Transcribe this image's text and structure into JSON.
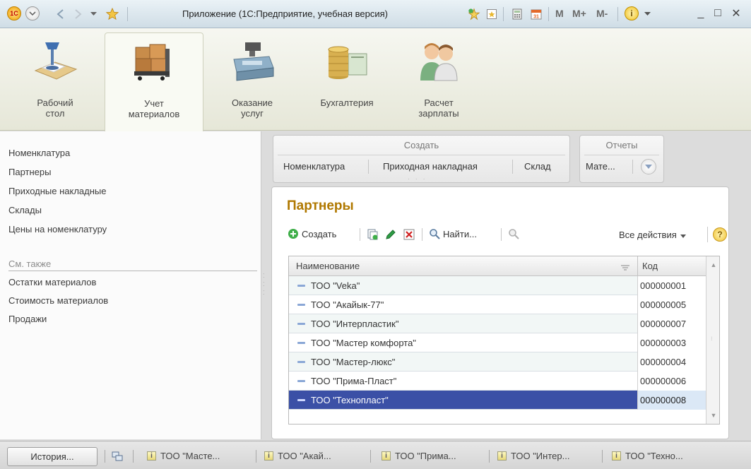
{
  "titlebar": {
    "logo_text": "1С",
    "title": "Приложение  (1С:Предприятие, учебная версия)",
    "icons": [
      "back-arrow",
      "forward-arrow",
      "dropdown-arrow",
      "favorite-star",
      "add-to-favorites",
      "history-bookmark",
      "calculator",
      "calendar"
    ],
    "memory_buttons": [
      "M",
      "M+",
      "M-"
    ],
    "info_glyph": "i",
    "window_controls": [
      "_",
      "□",
      "✕"
    ]
  },
  "sections": [
    {
      "label": "Рабочий\nстол",
      "icon": "desk-lamp-icon"
    },
    {
      "label": "Учет\nматериалов",
      "icon": "warehouse-boxes-icon",
      "active": true
    },
    {
      "label": "Оказание\nуслуг",
      "icon": "cash-register-icon"
    },
    {
      "label": "Бухгалтерия",
      "icon": "coins-icon"
    },
    {
      "label": "Расчет\nзарплаты",
      "icon": "employees-icon"
    }
  ],
  "nav": {
    "links": [
      "Номенклатура",
      "Партнеры",
      "Приходные накладные",
      "Склады",
      "Цены на номенклатуру"
    ],
    "see_also_title": "См. также",
    "see_also": [
      "Остатки материалов",
      "Стоимость материалов",
      "Продажи"
    ]
  },
  "create_group": {
    "title": "Создать",
    "commands": [
      "Номенклатура",
      "Приходная накладная",
      "Склад"
    ]
  },
  "reports_group": {
    "title": "Отчеты",
    "commands": [
      "Мате..."
    ]
  },
  "form": {
    "title": "Партнеры",
    "toolbar": {
      "create": "Создать",
      "find": "Найти...",
      "all_actions": "Все действия",
      "help": "?"
    },
    "columns": [
      "Наименование",
      "Код"
    ],
    "rows": [
      {
        "name": "ТОО \"Veka\"",
        "code": "000000001"
      },
      {
        "name": "ТОО \"Акайык-77\"",
        "code": "000000005"
      },
      {
        "name": "ТОО \"Интерпластик\"",
        "code": "000000007"
      },
      {
        "name": "ТОО \"Мастер комфорта\"",
        "code": "000000003"
      },
      {
        "name": "ТОО \"Мастер-люкс\"",
        "code": "000000004"
      },
      {
        "name": "ТОО \"Прима-Пласт\"",
        "code": "000000006"
      },
      {
        "name": "ТОО \"Технопласт\"",
        "code": "000000008",
        "selected": true
      }
    ]
  },
  "taskbar": {
    "history": "История...",
    "items": [
      "ТОО \"Масте...",
      "ТОО \"Акай...",
      "ТОО \"Прима...",
      "ТОО \"Интер...",
      "ТОО \"Техно..."
    ]
  }
}
